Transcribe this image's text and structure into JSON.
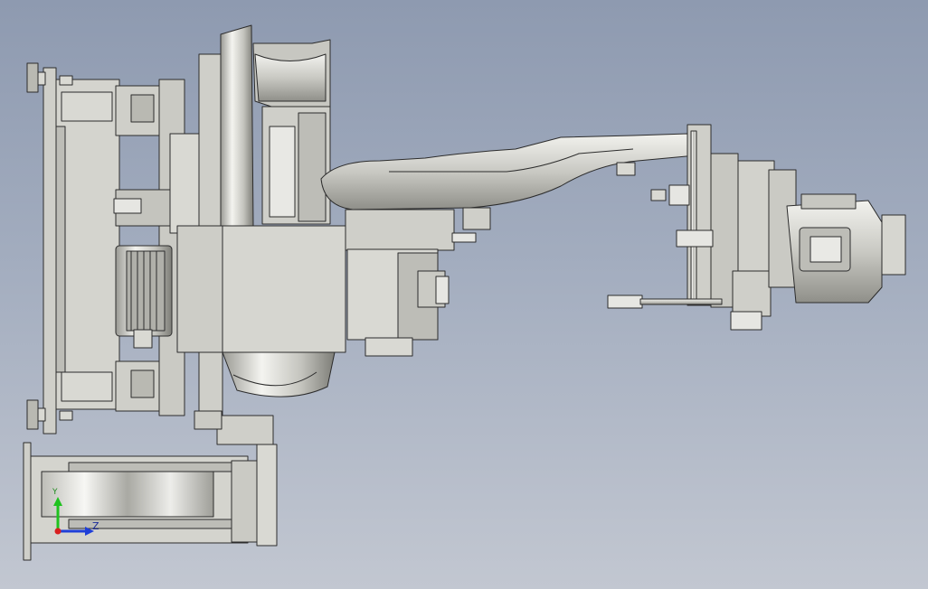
{
  "viewport": {
    "background_top": "#8e9ab0",
    "background_bottom": "#c2c7d1",
    "part_fill": "#d9d9d3",
    "part_shade": "#b9b9b2",
    "edge_color": "#2c2c2c"
  },
  "triad": {
    "y_label": "Y",
    "z_label": "Z",
    "y_color": "#1fc21f",
    "z_color": "#1f3fd8",
    "x_color": "#d81f1f"
  }
}
